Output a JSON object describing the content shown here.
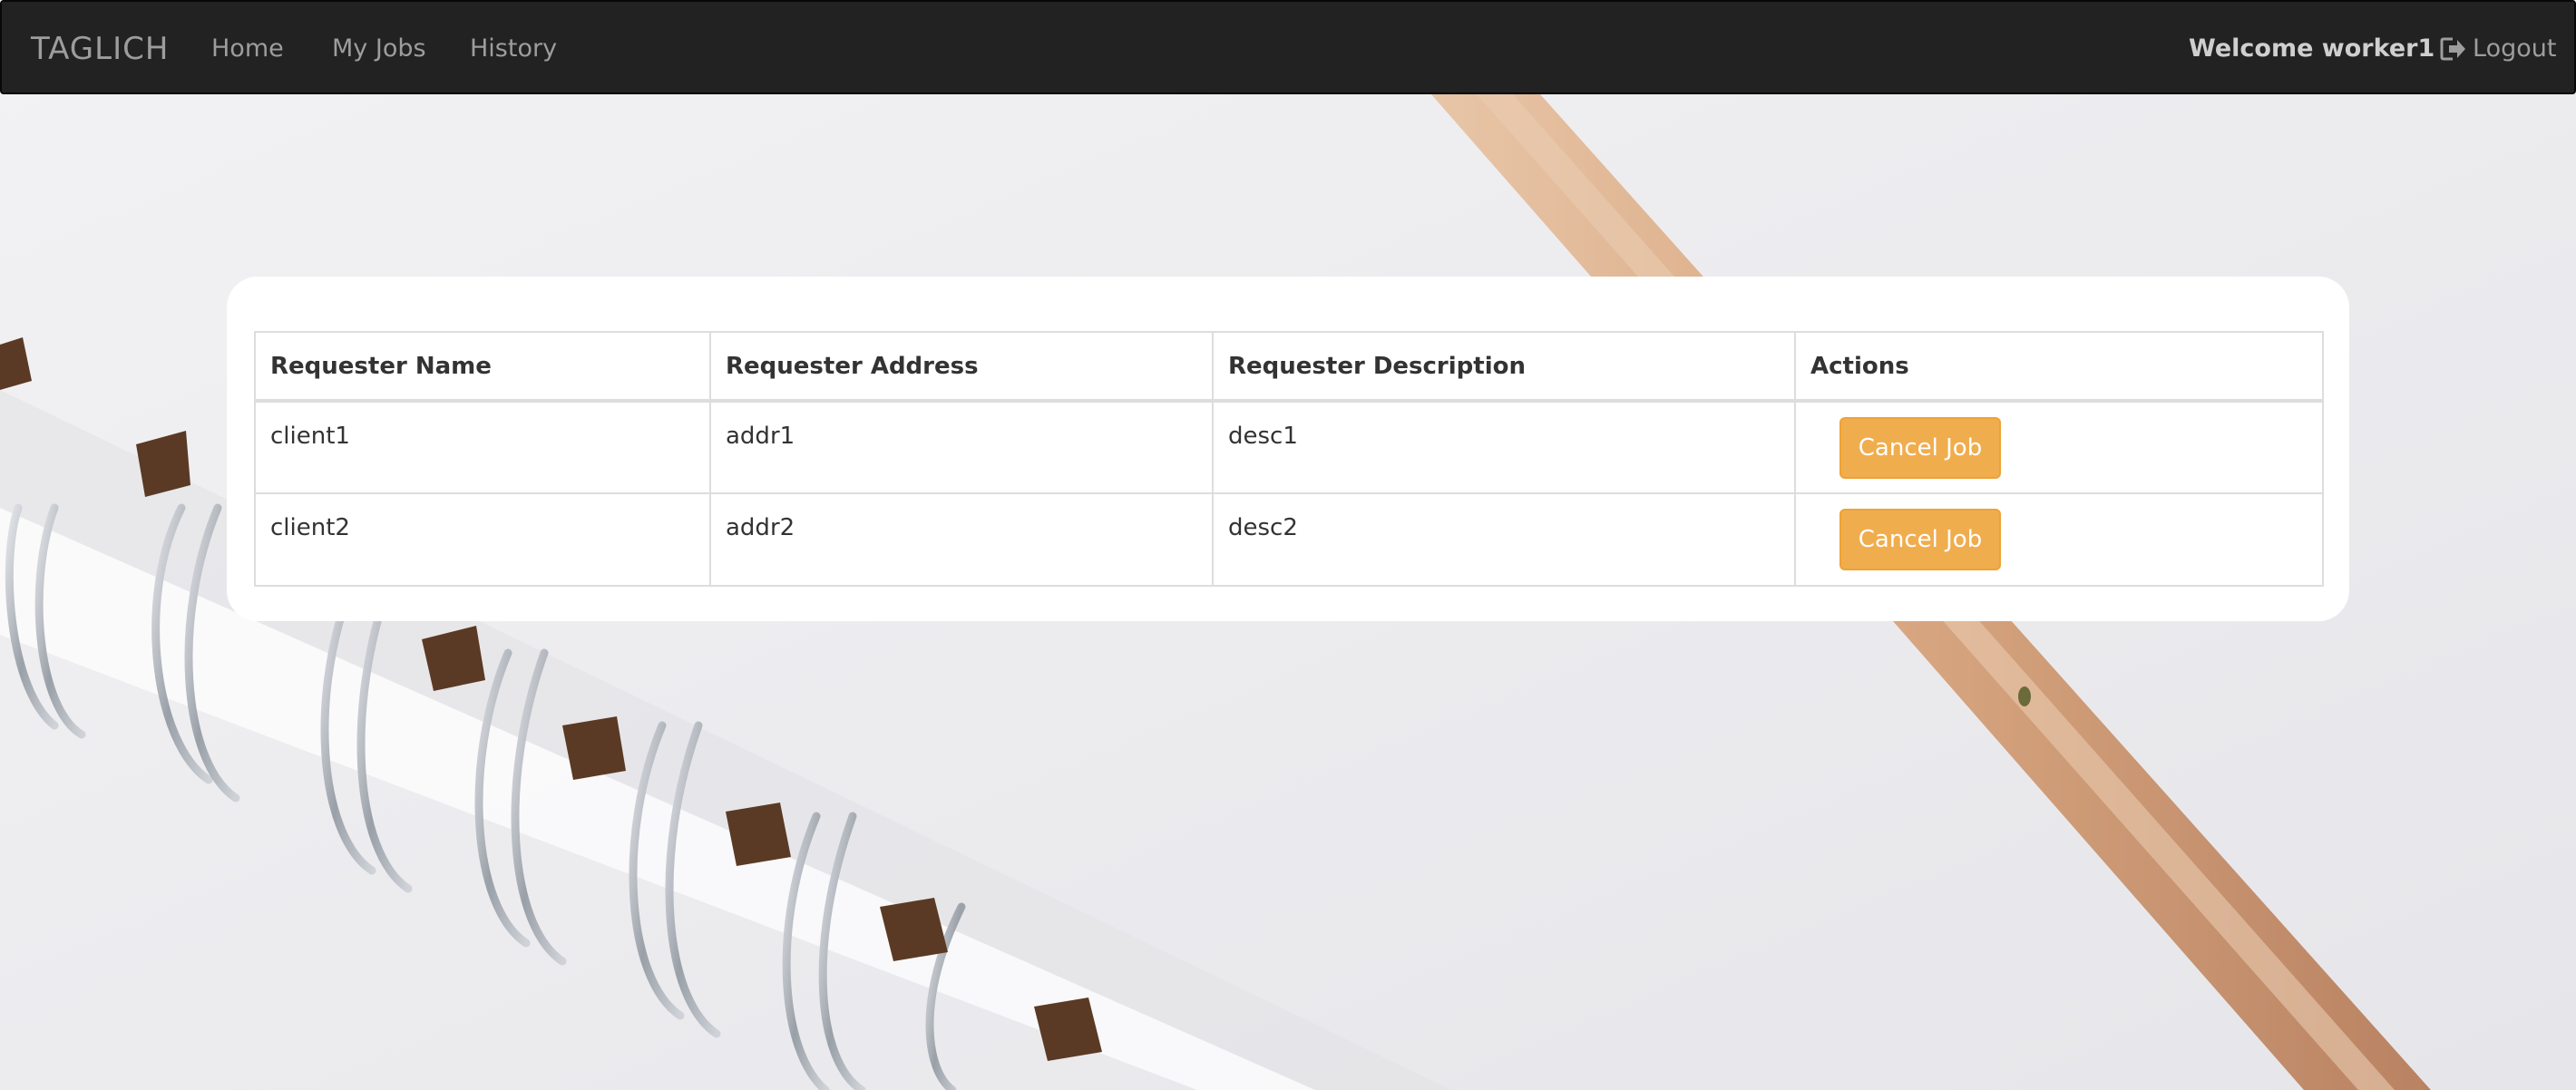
{
  "navbar": {
    "brand": "TAGLICH",
    "links": [
      {
        "label": "Home"
      },
      {
        "label": "My Jobs"
      },
      {
        "label": "History"
      }
    ],
    "welcome_text": "Welcome worker1",
    "logout_label": "Logout",
    "logout_icon": "logout-icon"
  },
  "jobs_table": {
    "columns": [
      "Requester Name",
      "Requester Address",
      "Requester Description",
      "Actions"
    ],
    "rows": [
      {
        "name": "client1",
        "address": "addr1",
        "description": "desc1",
        "action_label": "Cancel Job"
      },
      {
        "name": "client2",
        "address": "addr2",
        "description": "desc2",
        "action_label": "Cancel Job"
      }
    ]
  },
  "colors": {
    "navbar_bg": "#222222",
    "nav_text": "#9d9d9d",
    "button_warning": "#f0ad4e",
    "panel_bg": "#ffffff"
  }
}
